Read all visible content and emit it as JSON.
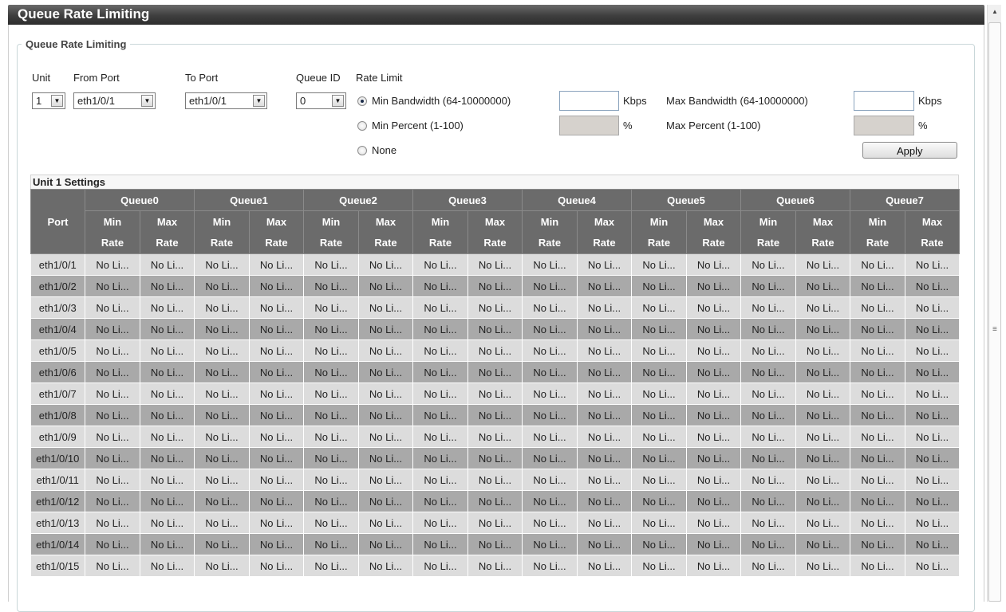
{
  "title": "Queue Rate Limiting",
  "group_legend": "Queue Rate Limiting",
  "form": {
    "unit_label": "Unit",
    "unit_value": "1",
    "from_port_label": "From Port",
    "from_port_value": "eth1/0/1",
    "to_port_label": "To Port",
    "to_port_value": "eth1/0/1",
    "queue_id_label": "Queue ID",
    "queue_id_value": "0",
    "rate_limit_label": "Rate Limit",
    "min_bandwidth_label": "Min Bandwidth (64-10000000)",
    "min_bandwidth_value": "",
    "min_bandwidth_unit": "Kbps",
    "max_bandwidth_label": "Max Bandwidth (64-10000000)",
    "max_bandwidth_value": "",
    "max_bandwidth_unit": "Kbps",
    "min_percent_label": "Min Percent (1-100)",
    "min_percent_unit": "%",
    "max_percent_label": "Max Percent (1-100)",
    "max_percent_unit": "%",
    "none_label": "None",
    "selected_rate_option": "min_bandwidth",
    "apply_label": "Apply"
  },
  "settings": {
    "title": "Unit 1 Settings",
    "port_header": "Port",
    "queues": [
      "Queue0",
      "Queue1",
      "Queue2",
      "Queue3",
      "Queue4",
      "Queue5",
      "Queue6",
      "Queue7"
    ],
    "min_label": "Min",
    "max_label": "Max",
    "rate_label": "Rate",
    "cell_value": "No Li...",
    "rows": [
      "eth1/0/1",
      "eth1/0/2",
      "eth1/0/3",
      "eth1/0/4",
      "eth1/0/5",
      "eth1/0/6",
      "eth1/0/7",
      "eth1/0/8",
      "eth1/0/9",
      "eth1/0/10",
      "eth1/0/11",
      "eth1/0/12",
      "eth1/0/13",
      "eth1/0/14",
      "eth1/0/15"
    ]
  },
  "icons": {
    "dropdown": "chevron-down-icon",
    "scroll_up": "arrow-up-icon",
    "scroll_grip": "grip-icon"
  },
  "colors": {
    "title_bar": "#3e3e3e",
    "table_header": "#6b6b6b",
    "row_light": "#dcdcdc",
    "row_dark": "#a9a9a9",
    "disabled_input": "#d6d2cd"
  }
}
